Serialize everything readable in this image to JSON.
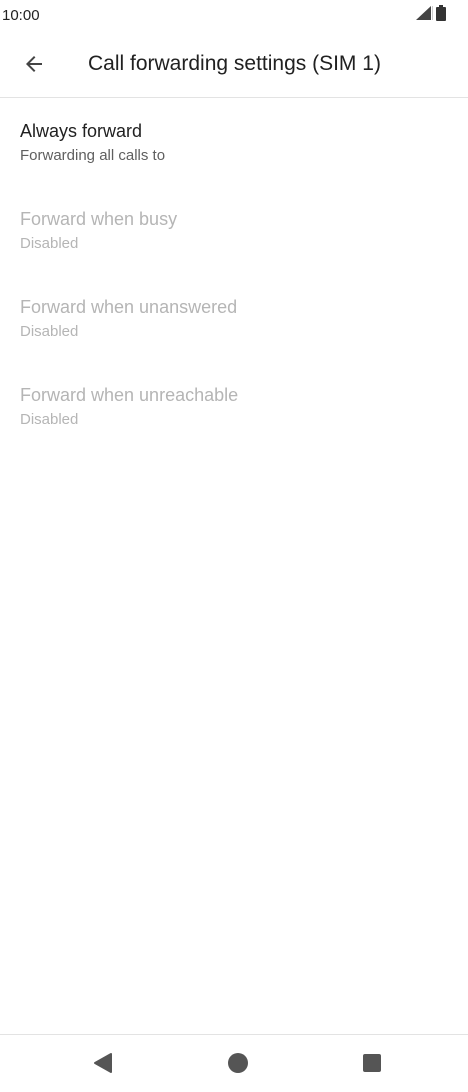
{
  "status_bar": {
    "time": "10:00",
    "icons": [
      "signal-icon",
      "battery-icon"
    ]
  },
  "app_bar": {
    "title": "Call forwarding settings (SIM 1)",
    "back_icon": "arrow-back-icon"
  },
  "preferences": [
    {
      "title": "Always forward",
      "summary": "Forwarding all calls to",
      "enabled": true
    },
    {
      "title": "Forward when busy",
      "summary": "Disabled",
      "enabled": false
    },
    {
      "title": "Forward when unanswered",
      "summary": "Disabled",
      "enabled": false
    },
    {
      "title": "Forward when unreachable",
      "summary": "Disabled",
      "enabled": false
    }
  ],
  "nav_bar": {
    "buttons": [
      "nav-back-icon",
      "nav-home-icon",
      "nav-recents-icon"
    ]
  },
  "colors": {
    "primary_text": "#212121",
    "secondary_text": "#5f5f5f",
    "disabled_text": "#b5b5b5",
    "divider": "#e3e3e3",
    "nav_icon": "#555555"
  }
}
